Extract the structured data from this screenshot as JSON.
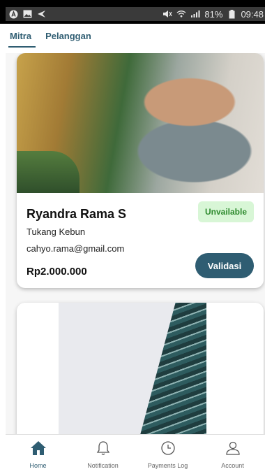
{
  "status_bar": {
    "battery": "81%",
    "time": "09:48",
    "icons_left": [
      "app-a-icon",
      "image-icon",
      "back-arrow-icon"
    ],
    "icons_right": [
      "mute-icon",
      "wifi-icon",
      "signal-icon",
      "battery-icon"
    ]
  },
  "tabs": [
    {
      "label": "Mitra",
      "active": true
    },
    {
      "label": "Pelanggan",
      "active": false
    }
  ],
  "cards": [
    {
      "name": "Ryandra Rama S",
      "role": "Tukang Kebun",
      "email": "cahyo.rama@gmail.com",
      "price": "Rp2.000.000",
      "status": "Unvailable",
      "action_label": "Validasi"
    }
  ],
  "bottom_nav": [
    {
      "label": "Home",
      "icon": "home-icon",
      "active": true
    },
    {
      "label": "Notification",
      "icon": "bell-icon",
      "active": false
    },
    {
      "label": "Payments Log",
      "icon": "clock-icon",
      "active": false
    },
    {
      "label": "Account",
      "icon": "user-icon",
      "active": false
    }
  ],
  "colors": {
    "primary": "#2f5d72",
    "badge_bg": "#d8f6d6",
    "badge_text": "#2e8a2e"
  }
}
